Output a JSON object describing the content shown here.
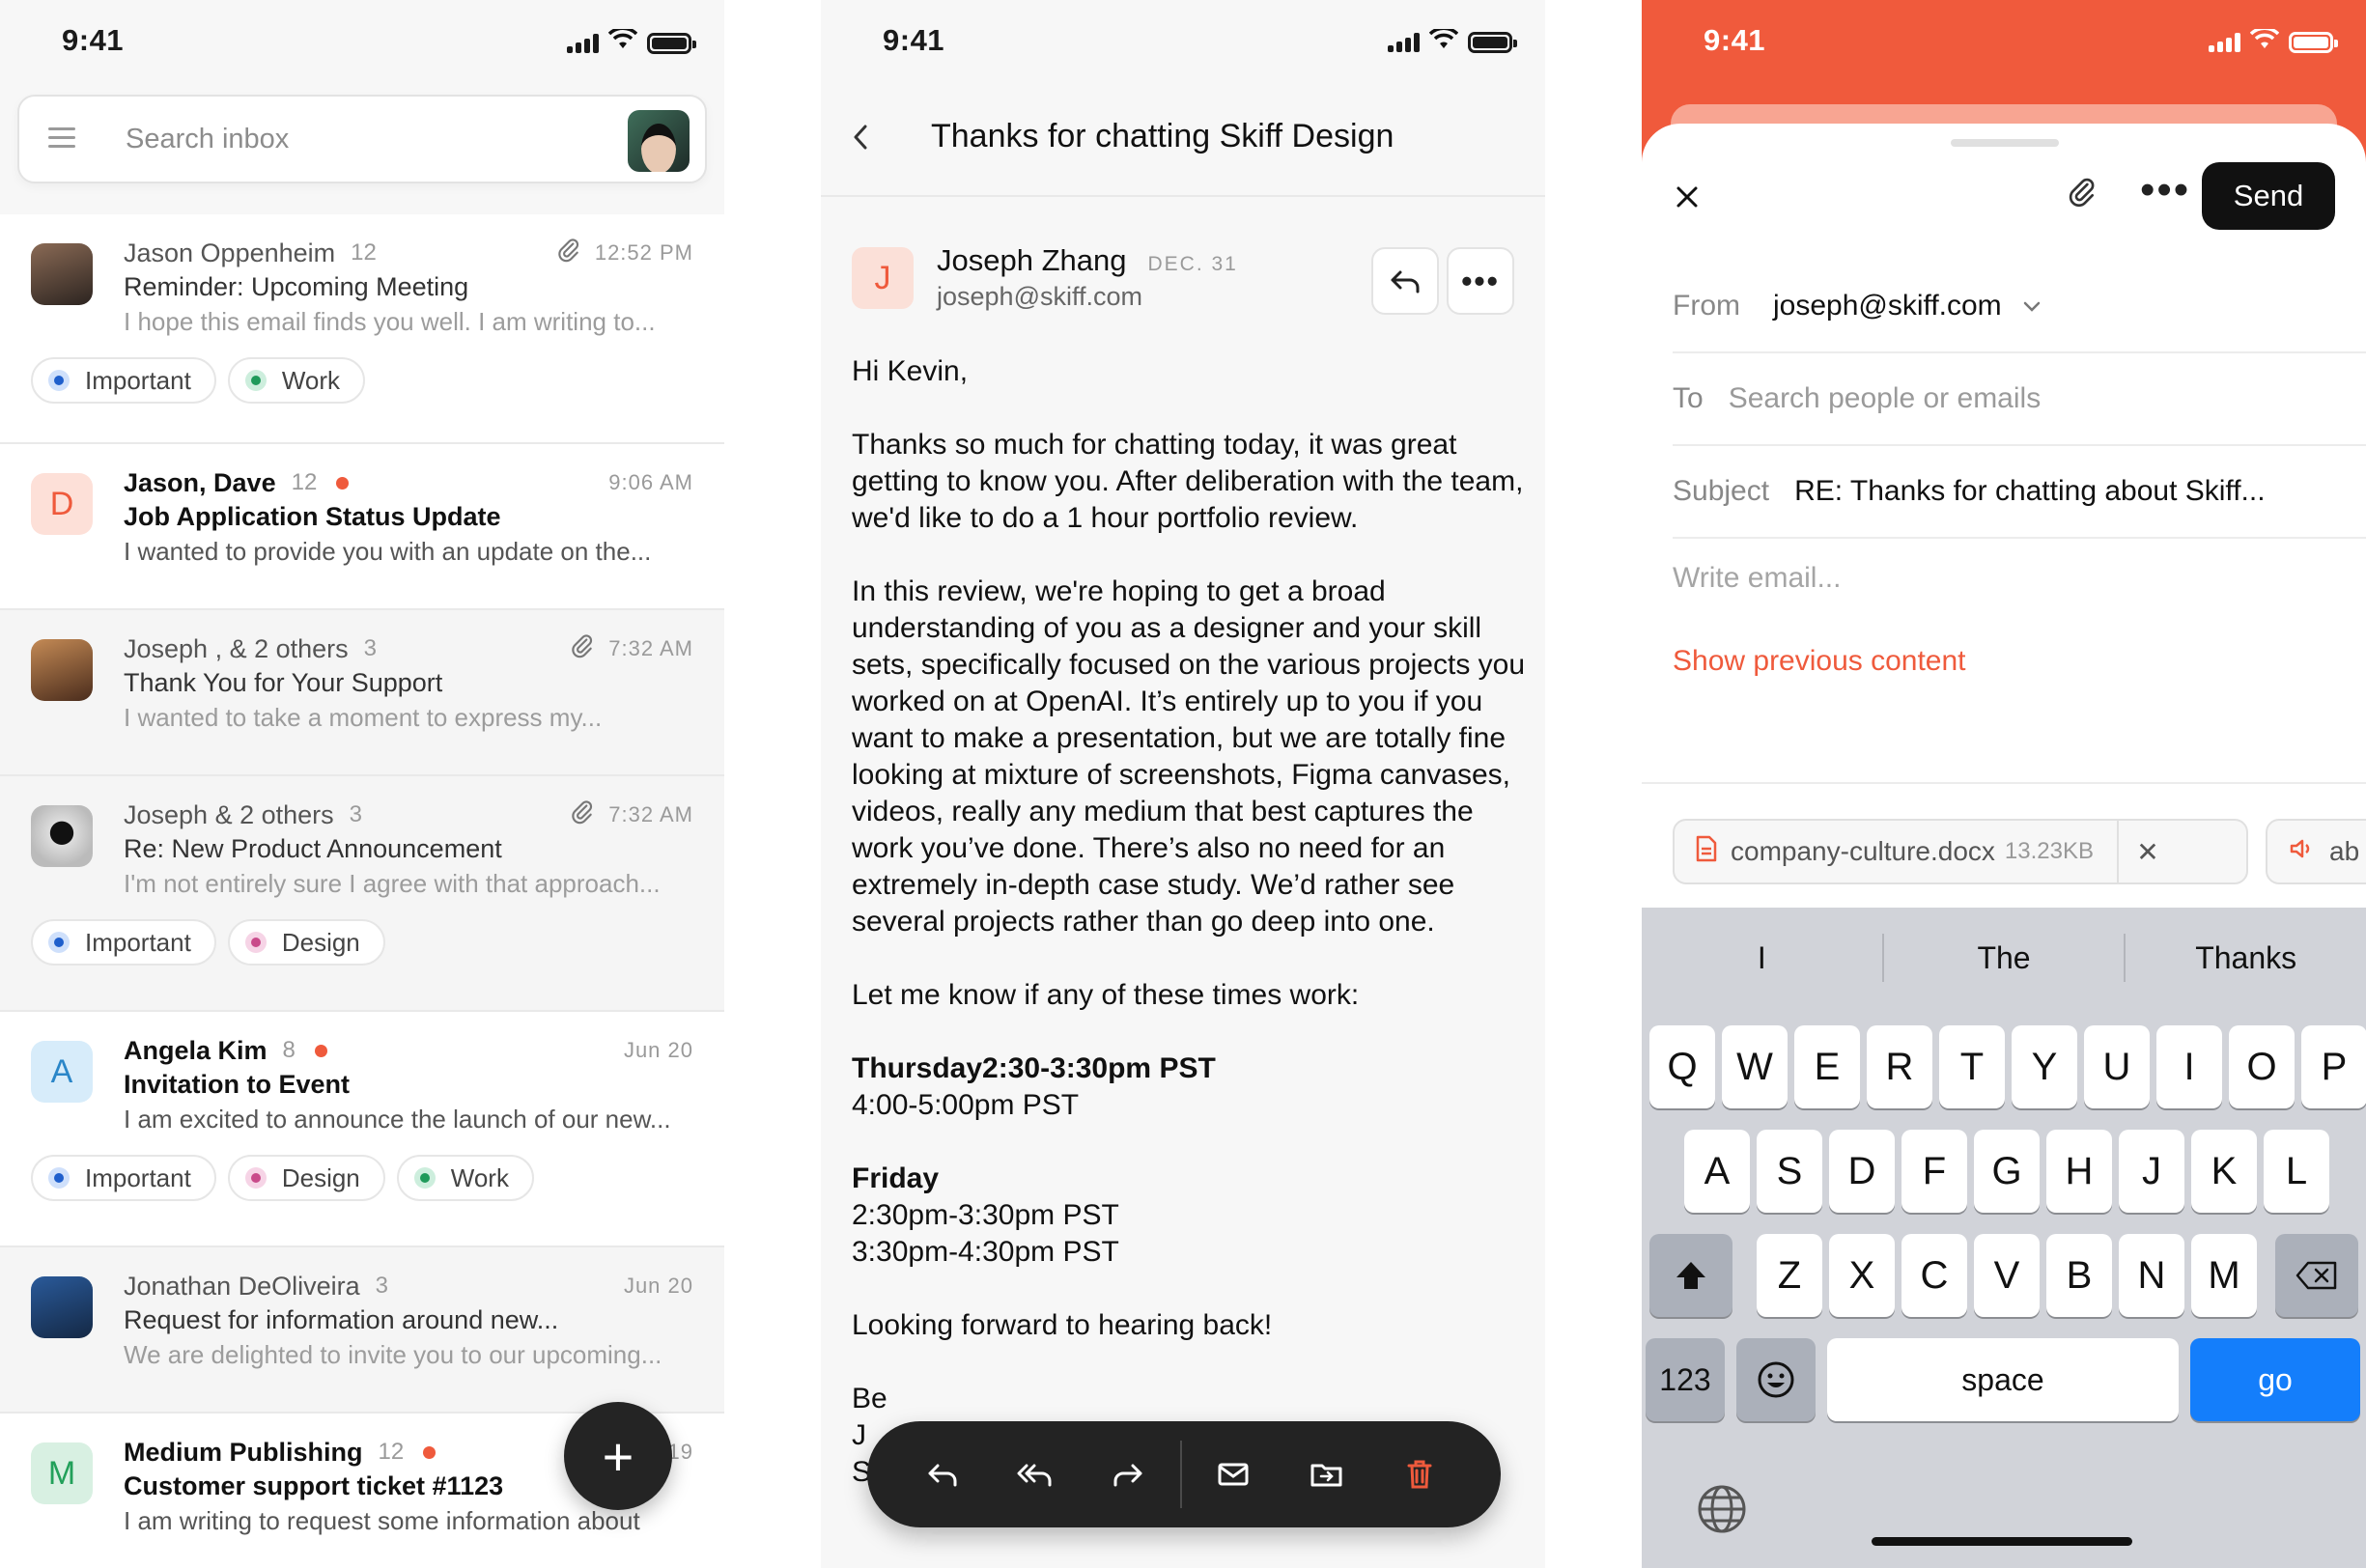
{
  "status": {
    "time": "9:41"
  },
  "inbox": {
    "search_placeholder": "Search inbox",
    "emails": [
      {
        "sender": "Jason Oppenheim",
        "count": "12",
        "time": "12:52 PM",
        "subject": "Reminder: Upcoming Meeting",
        "preview": "I hope this email finds you well. I am writing to...",
        "tags": [
          "Important",
          "Work"
        ]
      },
      {
        "sender": "Jason, Dave",
        "count": "12",
        "time": "9:06 AM",
        "subject": "Job Application Status Update",
        "preview": "I wanted to provide you with an update on the...",
        "initial": "D"
      },
      {
        "sender": "Joseph , & 2 others",
        "count": "3",
        "time": "7:32 AM",
        "subject": "Thank You for Your Support",
        "preview": "I wanted to take a moment to express my..."
      },
      {
        "sender": "Joseph & 2 others",
        "count": "3",
        "time": "7:32 AM",
        "subject": "Re: New Product Announcement",
        "preview": "I'm not entirely sure I agree with that approach...",
        "tags": [
          "Important",
          "Design"
        ]
      },
      {
        "sender": "Angela Kim",
        "count": "8",
        "time": "Jun 20",
        "subject": "Invitation to Event",
        "preview": "I am excited to announce the launch of our new...",
        "initial": "A",
        "tags": [
          "Important",
          "Design",
          "Work"
        ]
      },
      {
        "sender": "Jonathan DeOliveira",
        "count": "3",
        "time": "Jun 20",
        "subject": "Request for information around new...",
        "preview": "We are delighted to invite you to our upcoming..."
      },
      {
        "sender": "Medium Publishing",
        "count": "12",
        "time": "Jun 19",
        "subject": "Customer support ticket #1123",
        "preview": "I am writing to request some information about",
        "initial": "M"
      }
    ],
    "fab_label": "+"
  },
  "read": {
    "title": "Thanks for chatting Skiff Design",
    "sender_initial": "J",
    "sender_name": "Joseph Zhang",
    "date": "DEC. 31",
    "sender_email": "joseph@skiff.com",
    "greeting": "Hi Kevin,",
    "para1": "Thanks so much for chatting today, it was great getting to know you. After deliberation with the team, we'd like to do a 1 hour portfolio review.",
    "para2": "In this review, we're hoping to get a broad understanding of you as a designer and your skill sets, specifically focused on the various projects you worked on at OpenAI. It’s entirely up to you if you want to make a presentation, but we are totally fine looking at mixture of screenshots, Figma canvases, videos, really any medium that best captures the work you’ve done. There’s also no need for an extremely in-depth case study. We’d rather see several projects rather than go deep into one.",
    "para3": "Let me know if any of these times work:",
    "thursday_heading": "Thursday2:30-3:30pm PST",
    "thursday_slot": "4:00-5:00pm PST",
    "friday_heading": "Friday",
    "friday_slot1": "2:30pm-3:30pm PST",
    "friday_slot2": "3:30pm-4:30pm PST",
    "closing": "Looking forward to hearing back!",
    "signoff_partial": "Be",
    "sign_name_partial": "J",
    "sign_line3_partial": "Se"
  },
  "compose": {
    "send_label": "Send",
    "from_label": "From",
    "from_value": "joseph@skiff.com",
    "to_label": "To",
    "to_placeholder": "Search people or emails",
    "subject_label": "Subject",
    "subject_value": "RE: Thanks for chatting about Skiff...",
    "body_placeholder": "Write email...",
    "show_previous": "Show previous content",
    "attachment_name": "company-culture.docx",
    "attachment_size": "13.23KB",
    "attachment2_partial": "ab"
  },
  "keyboard": {
    "suggestions": [
      "I",
      "The",
      "Thanks"
    ],
    "row1": [
      "Q",
      "W",
      "E",
      "R",
      "T",
      "Y",
      "U",
      "I",
      "O",
      "P"
    ],
    "row2": [
      "A",
      "S",
      "D",
      "F",
      "G",
      "H",
      "J",
      "K",
      "L"
    ],
    "row3": [
      "Z",
      "X",
      "C",
      "V",
      "B",
      "N",
      "M"
    ],
    "numbers_label": "123",
    "space_label": "space",
    "go_label": "go"
  },
  "colors": {
    "accent": "#EF5A3C",
    "dark": "#232323",
    "keyboard_go": "#147EFB"
  }
}
